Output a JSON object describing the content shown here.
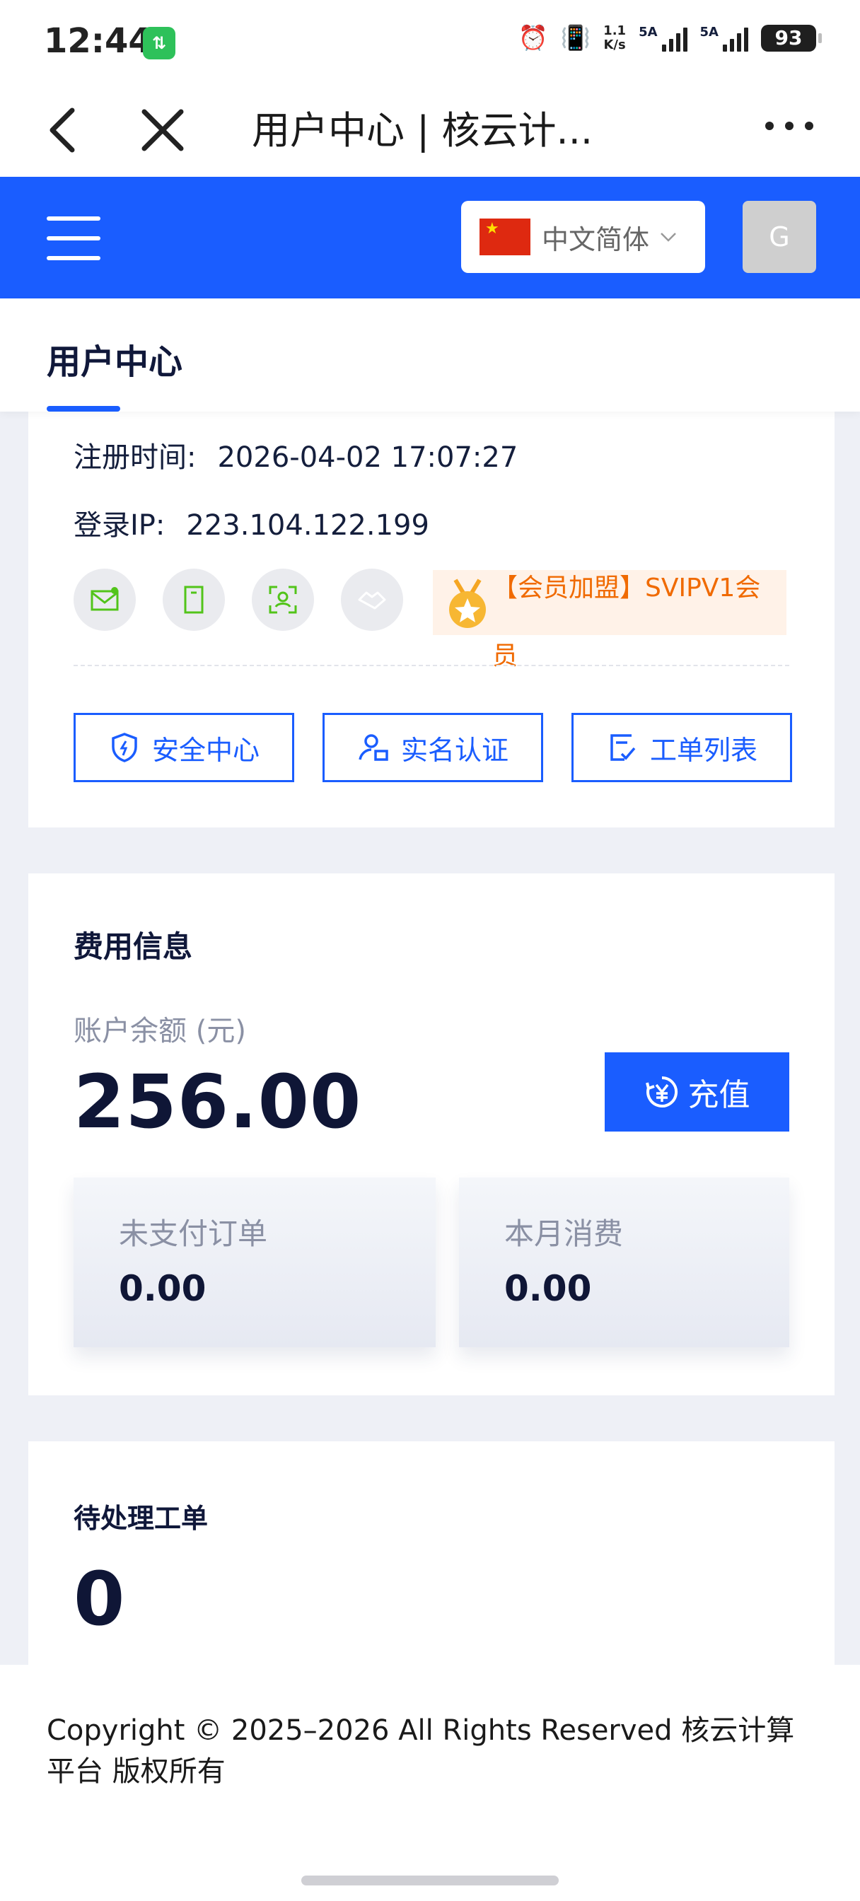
{
  "status_bar": {
    "time": "12:44",
    "data_badge": "⇅",
    "speed_top": "1.1",
    "speed_unit": "K/s",
    "signal1_label": "5A",
    "signal2_label": "5A",
    "battery": "93"
  },
  "browser": {
    "title": "用户中心 | 核云计..."
  },
  "header": {
    "language": "中文简体",
    "avatar_letter": "G"
  },
  "tabs": {
    "active_label": "用户中心"
  },
  "user_info": {
    "register_label": "注册时间:",
    "register_value": "2026-04-02 17:07:27",
    "ip_label": "登录IP:",
    "ip_value": "223.104.122.199",
    "member_badge": "【会员加盟】SVIPV1会员",
    "actions": [
      {
        "label": "安全中心",
        "icon": "shield-icon"
      },
      {
        "label": "实名认证",
        "icon": "user-verify-icon"
      },
      {
        "label": "工单列表",
        "icon": "ticket-list-icon"
      }
    ]
  },
  "fees": {
    "title": "费用信息",
    "balance_label": "账户余额 (元)",
    "balance_value": "256.00",
    "recharge_label": "充值",
    "unpaid_label": "未支付订单",
    "unpaid_value": "0.00",
    "month_label": "本月消费",
    "month_value": "0.00"
  },
  "tickets": {
    "title": "待处理工单",
    "count": "0"
  },
  "footer": {
    "copyright": "Copyright © 2025–2026 All Rights Reserved 核云计算平台 版权所有"
  },
  "colors": {
    "brand_blue": "#1a5dff",
    "member_orange": "#f06a00",
    "verify_green": "#52c41a"
  }
}
